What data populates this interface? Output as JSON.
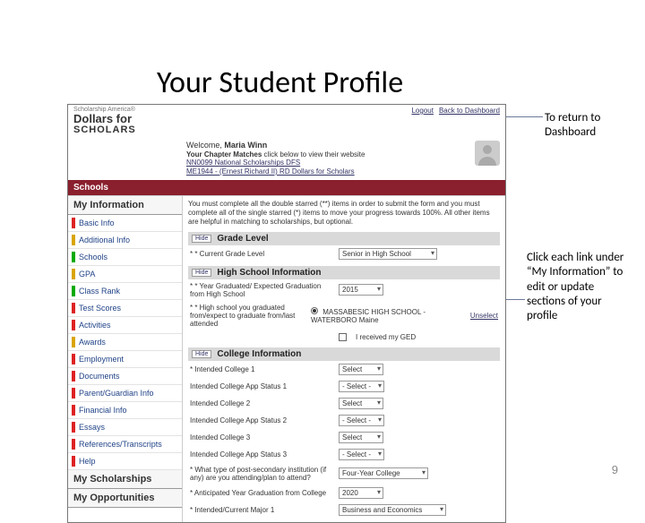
{
  "slide": {
    "title": "Your Student Profile",
    "page_number": "9"
  },
  "callouts": {
    "top": "To return to Dashboard",
    "mid": "Click each link under “My Information” to edit or update sections of your profile"
  },
  "header": {
    "scholarship_america": "Scholarship America®",
    "brand_line1": "Dollars for",
    "brand_line2": "SCHOLARS",
    "logout": "Logout",
    "back": "Back to Dashboard"
  },
  "welcome": {
    "name_prefix": "Welcome,",
    "name": "Maria Winn",
    "chapter_bold": "Your Chapter Matches",
    "chapter_rest": "click below to view their website",
    "sub1": "NN0099  National Scholarships  DFS",
    "sub2": "ME1944 - (Ernest Richard II) RD Dollars for Scholars"
  },
  "nav_bar": "Schools",
  "sidebar": {
    "head1": "My Information",
    "items": [
      {
        "label": "Basic Info",
        "color": "#d22"
      },
      {
        "label": "Additional Info",
        "color": "#d9a400"
      },
      {
        "label": "Schools",
        "color": "#0a0"
      },
      {
        "label": "GPA",
        "color": "#d9a400"
      },
      {
        "label": "Class Rank",
        "color": "#0a0"
      },
      {
        "label": "Test Scores",
        "color": "#d22"
      },
      {
        "label": "Activities",
        "color": "#d22"
      },
      {
        "label": "Awards",
        "color": "#d9a400"
      },
      {
        "label": "Employment",
        "color": "#d22"
      },
      {
        "label": "Documents",
        "color": "#d22"
      },
      {
        "label": "Parent/Guardian Info",
        "color": "#d22"
      },
      {
        "label": "Financial Info",
        "color": "#d22"
      },
      {
        "label": "Essays",
        "color": "#d22"
      },
      {
        "label": "References/Transcripts",
        "color": "#d22"
      },
      {
        "label": "Help",
        "color": "#d22"
      }
    ],
    "head2": "My Scholarships",
    "head3": "My Opportunities"
  },
  "main": {
    "intro": "You must complete all the double starred (**) items in order to submit the form and you must complete all of the single starred (*) items to move your progress towards 100%. All other items are helpful in matching to scholarships, but optional.",
    "hide": "Hide",
    "sections": {
      "grade": {
        "title": "Grade Level",
        "grade_label": "* * Current Grade Level",
        "grade_value": "Senior in High School"
      },
      "hs": {
        "title": "High School Information",
        "grad_year_label": "* * Year Graduated/ Expected Graduation from High School",
        "grad_year_value": "2015",
        "prev_hs_label": "* * High school you graduated from/expect to graduate from/last attended",
        "prev_hs_value": "MASSABESIC HIGH SCHOOL - WATERBORO Maine",
        "unselect": "Unselect",
        "ged_label": "I received my GED"
      },
      "college": {
        "title": "College Information",
        "c1": "* Intended College 1",
        "c1s": "Intended College App Status 1",
        "c2": "Intended College 2",
        "c2s": "Intended College App Status 2",
        "c3": "Intended College 3",
        "c3s": "Intended College App Status 3",
        "sel_placeholder": "- Select -",
        "sel_blank": "Select",
        "type_label": "* What type of post-secondary institution (if any) are you attending/plan to attend?",
        "type_value": "Four-Year College",
        "ay_label": "* Anticipated Year Graduation from College",
        "ay_value": "2020",
        "major_label": "* Intended/Current Major 1",
        "major_value": "Business and Economics"
      }
    }
  }
}
